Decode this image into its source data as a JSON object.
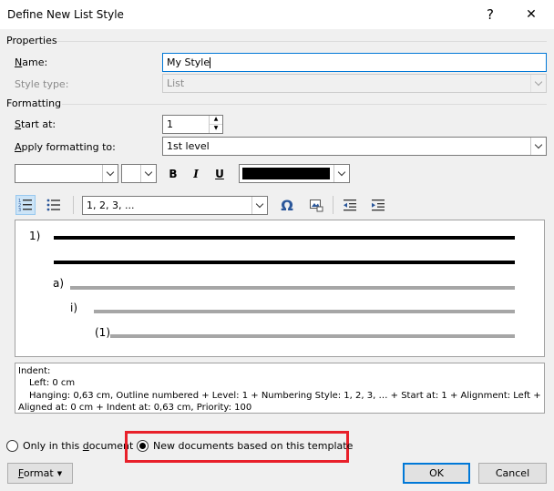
{
  "window": {
    "title": "Define New List Style",
    "help_glyph": "?",
    "close_glyph": "✕"
  },
  "properties": {
    "section_label": "Properties",
    "name_label": "Name:",
    "name_value": "My Style",
    "style_type_label": "Style type:",
    "style_type_value": "List"
  },
  "formatting": {
    "section_label": "Formatting",
    "start_at_label": "Start at:",
    "start_at_value": "1",
    "apply_label": "Apply formatting to:",
    "apply_value": "1st level",
    "font_value": "",
    "size_value": "",
    "bold_glyph": "B",
    "italic_glyph": "I",
    "underline_glyph": "U",
    "font_color": "#000000",
    "number_style_value": "1, 2, 3, ...",
    "symbol_glyph": "Ω"
  },
  "preview": {
    "level1_label": "1)",
    "level2_label": "a)",
    "level3_label": "i)",
    "level4_label": "(1)"
  },
  "description": {
    "line1": "Indent:",
    "line2": "Left:  0 cm",
    "line3": "Hanging:  0,63 cm, Outline numbered + Level: 1 + Numbering Style: 1, 2, 3, … + Start at: 1 + Alignment: Left +",
    "line4": "Aligned at:  0 cm + Indent at:  0,63 cm, Priority: 100"
  },
  "options": {
    "only_doc_label": "Only in this document",
    "new_docs_label": "New documents based on this template",
    "selected": "new_docs"
  },
  "buttons": {
    "format_label": "Format",
    "ok_label": "OK",
    "cancel_label": "Cancel"
  },
  "colors": {
    "highlight": "#e8202a",
    "accent": "#0078d7",
    "selected_tool": "#cce4f7"
  },
  "icons": [
    "help-icon",
    "close-icon",
    "numbered-list-icon",
    "bulleted-list-icon",
    "symbol-icon",
    "picture-bullet-icon",
    "decrease-indent-icon",
    "increase-indent-icon",
    "chevron-down-icon"
  ]
}
